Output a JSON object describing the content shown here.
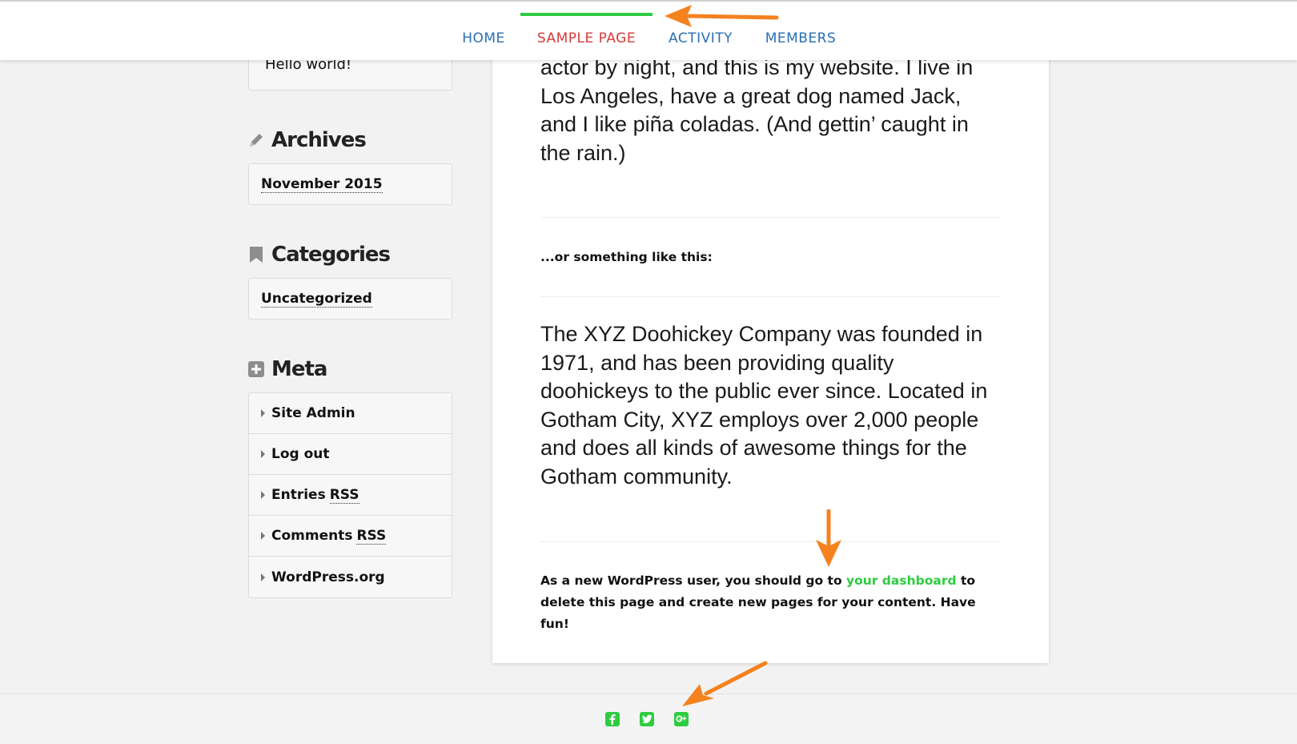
{
  "nav": {
    "items": [
      {
        "label": "HOME"
      },
      {
        "label": "SAMPLE PAGE",
        "active": true
      },
      {
        "label": "ACTIVITY"
      },
      {
        "label": "MEMBERS"
      }
    ]
  },
  "sidebar": {
    "recent_post": "Hello world!",
    "archives": {
      "title": "Archives",
      "items": [
        "November 2015"
      ]
    },
    "categories": {
      "title": "Categories",
      "items": [
        "Uncategorized"
      ]
    },
    "meta": {
      "title": "Meta",
      "items": [
        {
          "label": "Site Admin",
          "abbr": ""
        },
        {
          "label": "Log out",
          "abbr": ""
        },
        {
          "label": "Entries",
          "abbr": "RSS"
        },
        {
          "label": "Comments",
          "abbr": "RSS"
        },
        {
          "label": "WordPress.org",
          "abbr": ""
        }
      ]
    }
  },
  "content": {
    "intro": "actor by night, and this is my website. I live in Los Angeles, have a great dog named Jack, and I like piña coladas. (And gettin’ caught in the rain.)",
    "or_something": "...or something like this:",
    "company": "The XYZ Doohickey Company was founded in 1971, and has been providing quality doohickeys to the public ever since. Located in Gotham City, XYZ employs over 2,000 people and does all kinds of awesome things for the Gotham community.",
    "closing_before": "As a new WordPress user, you should go to ",
    "closing_link": "your dashboard",
    "closing_after": " to delete this page and create new pages for your content. Have fun!"
  },
  "footer": {
    "social": [
      "facebook-icon",
      "twitter-icon",
      "google-plus-icon"
    ]
  },
  "colors": {
    "accent": "#2ecc40",
    "nav_link": "#2a6fb3",
    "nav_active": "#d63b3b",
    "annotation_arrow": "#f5821f"
  }
}
